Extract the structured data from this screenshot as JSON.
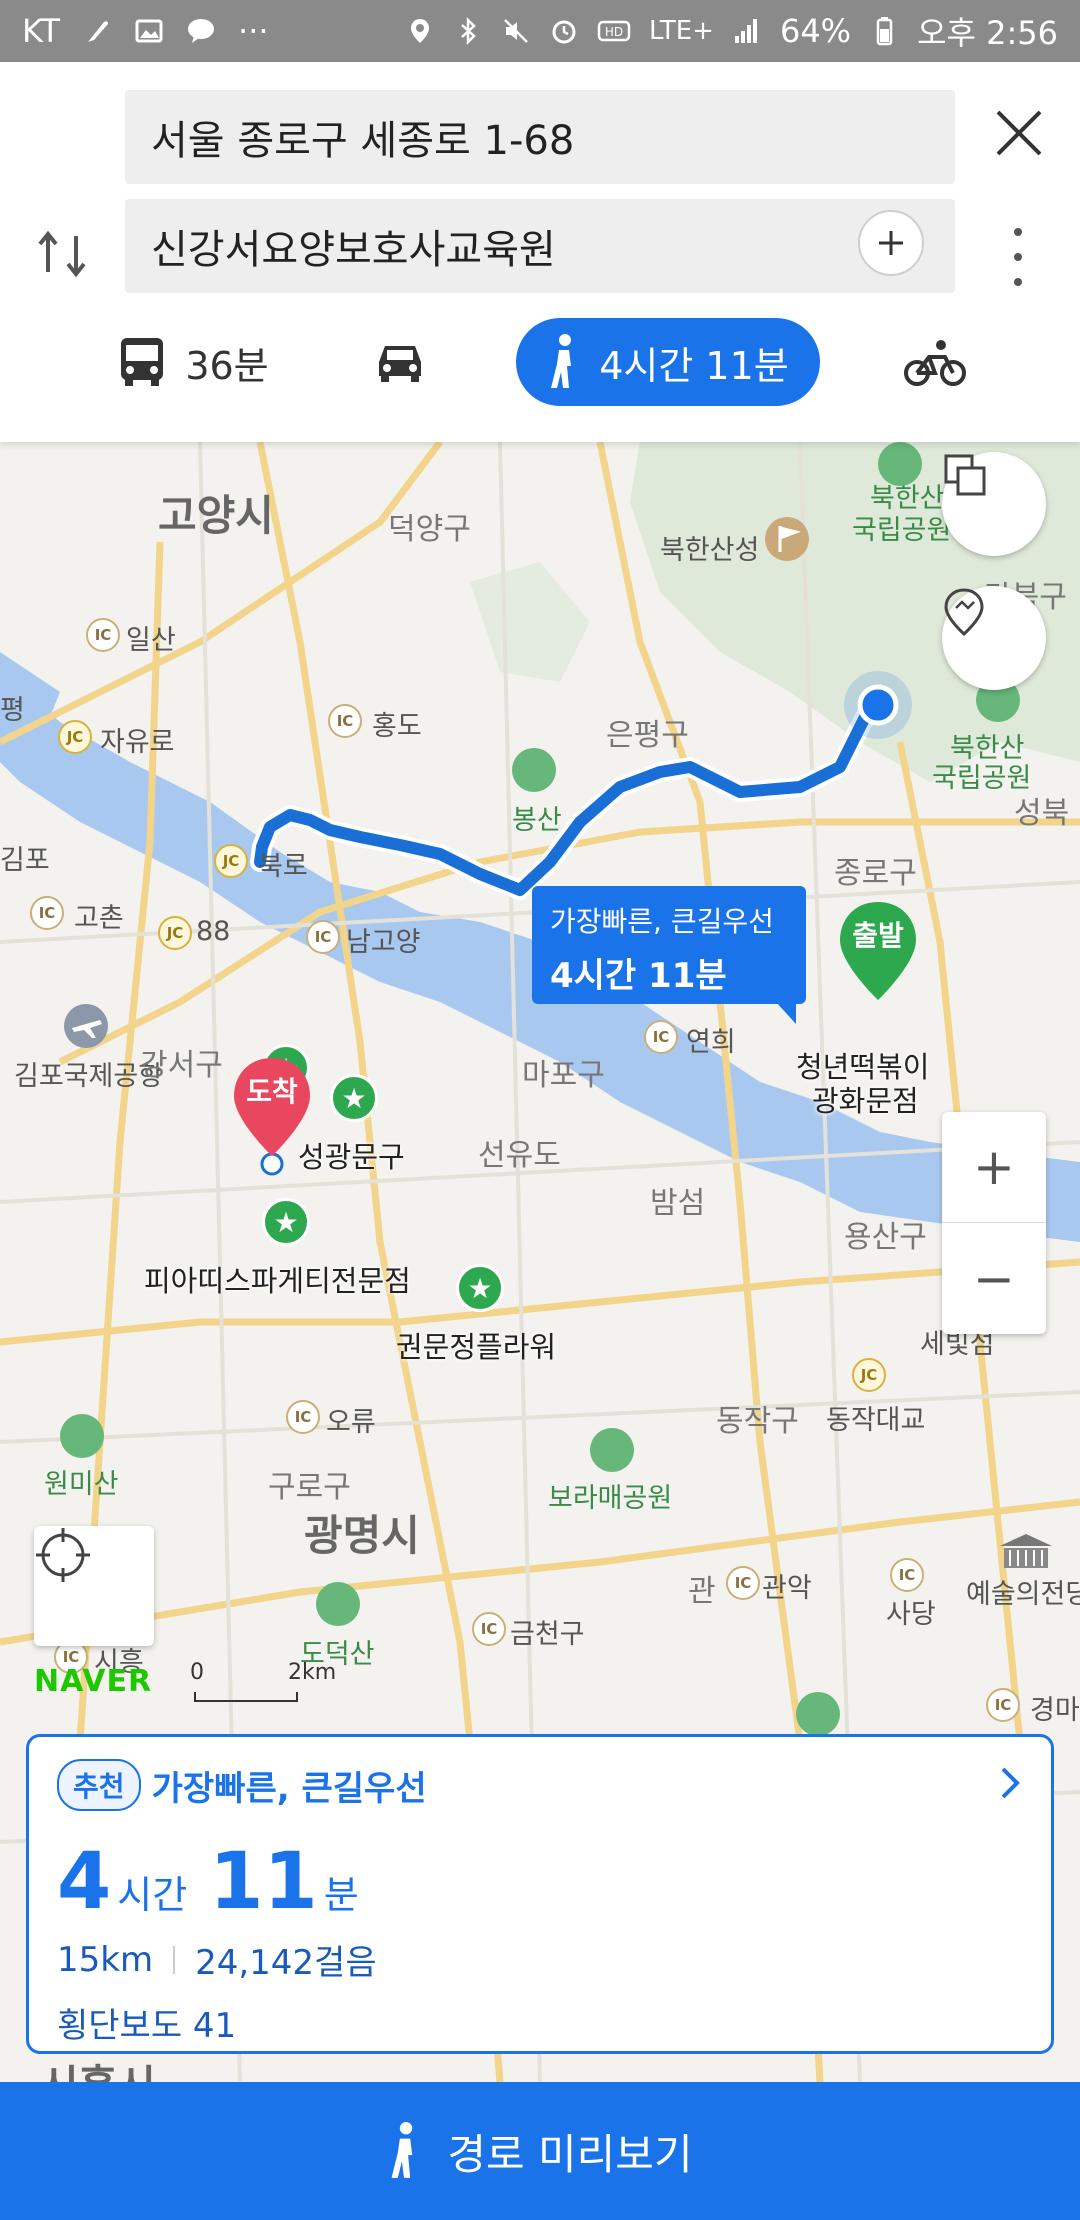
{
  "status_bar": {
    "carrier": "KT",
    "dots": "···",
    "network": "LTE+",
    "battery": "64%",
    "time": "오후 2:56"
  },
  "search": {
    "origin": "서울 종로구 세종로 1-68",
    "destination": "신강서요양보호사교육원"
  },
  "modes": {
    "transit_time": "36분",
    "walk_time": "4시간 11분",
    "active": "walk"
  },
  "map": {
    "labels": {
      "goyang": "고양시",
      "deogyang": "덕양구",
      "bukhansanseong": "북한산성",
      "bukhansan_np_1a": "북한산",
      "bukhansan_np_1b": "국립공원",
      "gangbuk": "강북구",
      "ilsan": "일산",
      "jayuro": "자유로",
      "hongdo": "홍도",
      "eunpyeong": "은평구",
      "bukhansan_np_2a": "북한산",
      "bukhansan_np_2b": "국립공원",
      "seongbuk": "성북",
      "pyeong": "평",
      "bongsan": "봉산",
      "gimpo": "김포",
      "bungno": "북로",
      "jongno": "종로구",
      "goson": "고촌",
      "jc88": "88",
      "namgoyang": "남고양",
      "gimpo_airport": "김포국제공항",
      "gangseo": "강서구",
      "mapo": "마포구",
      "yeonhui": "연희",
      "seonyudo": "선유도",
      "seongwangmun": "성광문구",
      "cheongnyeon_a": "청년떡볶이",
      "cheongnyeon_b": "광화문점",
      "bamseom": "밤섬",
      "yongsan": "용산구",
      "piatti": "피아띠스파게티전문점",
      "gwonmunjeong": "권문정플라워",
      "sebitseom": "세빛섬",
      "oryu": "오류",
      "dongjak": "동작구",
      "dongjak_bridge": "동작대교",
      "wonmisan": "원미산",
      "guro": "구로구",
      "boramae": "보라매공원",
      "gwangmyeong": "광명시",
      "gwanak_a": "관",
      "gwanak_b": "관악",
      "sadang": "사당",
      "arts_center": "예술의전당",
      "geumcheon": "금천구",
      "dodeoksan": "도덕산",
      "siheung": "시흥",
      "gyeongma": "경마",
      "siheung_city": "시흥시"
    },
    "ic_text": "IC",
    "jc_text": "JC",
    "tooltip": {
      "title": "가장빠른, 큰길우선",
      "time": "4시간 11분"
    },
    "start_label": "출발",
    "end_label": "도착",
    "brand": "NAVER",
    "scale_zero": "0",
    "scale_km": "2km",
    "zoom_in": "+",
    "zoom_out": "−"
  },
  "route_card": {
    "badge": "추천",
    "title": "가장빠른, 큰길우선",
    "hours": "4",
    "hours_unit": "시간",
    "minutes": "11",
    "minutes_unit": "분",
    "distance": "15km",
    "steps": "24,142걸음",
    "crosswalks": "횡단보도 41"
  },
  "bottom_button": {
    "label": "경로 미리보기"
  },
  "colors": {
    "accent": "#1a73e8",
    "route": "#1a6fd6",
    "start_pin": "#2ea84f",
    "end_pin": "#e8475f",
    "river": "#a9c8f0"
  }
}
